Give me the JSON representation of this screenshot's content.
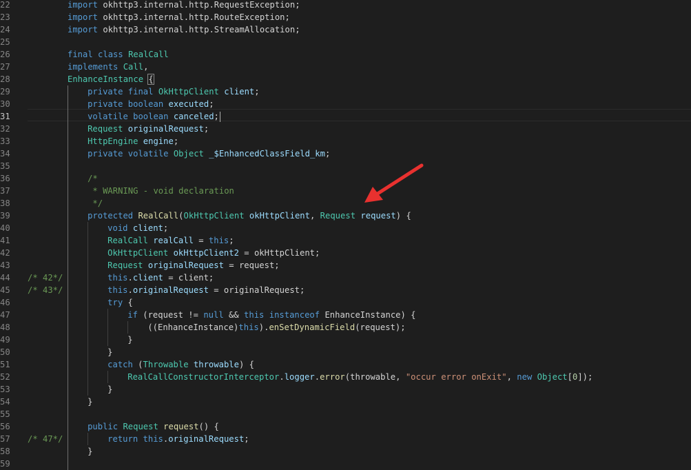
{
  "editor": {
    "lines": [
      {
        "n": "22",
        "indent": 0,
        "tokens": [
          [
            "kw",
            "import"
          ],
          [
            "pl",
            " okhttp3.internal.http.RequestException;"
          ]
        ]
      },
      {
        "n": "23",
        "indent": 0,
        "tokens": [
          [
            "kw",
            "import"
          ],
          [
            "pl",
            " okhttp3.internal.http.RouteException;"
          ]
        ]
      },
      {
        "n": "24",
        "indent": 0,
        "tokens": [
          [
            "kw",
            "import"
          ],
          [
            "pl",
            " okhttp3.internal.http.StreamAllocation;"
          ]
        ]
      },
      {
        "n": "25",
        "indent": 0,
        "tokens": []
      },
      {
        "n": "26",
        "indent": 0,
        "tokens": [
          [
            "kw",
            "final"
          ],
          [
            "pl",
            " "
          ],
          [
            "kw",
            "class"
          ],
          [
            "pl",
            " "
          ],
          [
            "ty",
            "RealCall"
          ]
        ]
      },
      {
        "n": "27",
        "indent": 0,
        "tokens": [
          [
            "kw",
            "implements"
          ],
          [
            "pl",
            " "
          ],
          [
            "ty",
            "Call"
          ],
          [
            "pl",
            ","
          ]
        ]
      },
      {
        "n": "28",
        "indent": 0,
        "tokens": [
          [
            "ty",
            "EnhanceInstance"
          ],
          [
            "pl",
            " "
          ],
          [
            "brace",
            "{"
          ]
        ]
      },
      {
        "n": "29",
        "indent": 1,
        "tokens": [
          [
            "kw",
            "private"
          ],
          [
            "pl",
            " "
          ],
          [
            "kw",
            "final"
          ],
          [
            "pl",
            " "
          ],
          [
            "ty",
            "OkHttpClient"
          ],
          [
            "pl",
            " "
          ],
          [
            "va",
            "client"
          ],
          [
            "pl",
            ";"
          ]
        ]
      },
      {
        "n": "30",
        "indent": 1,
        "tokens": [
          [
            "kw",
            "private"
          ],
          [
            "pl",
            " "
          ],
          [
            "kw",
            "boolean"
          ],
          [
            "pl",
            " "
          ],
          [
            "va",
            "executed"
          ],
          [
            "pl",
            ";"
          ]
        ]
      },
      {
        "n": "31",
        "indent": 1,
        "active": true,
        "tokens": [
          [
            "kw",
            "volatile"
          ],
          [
            "pl",
            " "
          ],
          [
            "kw",
            "boolean"
          ],
          [
            "pl",
            " "
          ],
          [
            "va",
            "canceled"
          ],
          [
            "pl",
            ";"
          ],
          [
            "cursor",
            ""
          ]
        ]
      },
      {
        "n": "32",
        "indent": 1,
        "tokens": [
          [
            "ty",
            "Request"
          ],
          [
            "pl",
            " "
          ],
          [
            "va",
            "originalRequest"
          ],
          [
            "pl",
            ";"
          ]
        ]
      },
      {
        "n": "33",
        "indent": 1,
        "tokens": [
          [
            "ty",
            "HttpEngine"
          ],
          [
            "pl",
            " "
          ],
          [
            "va",
            "engine"
          ],
          [
            "pl",
            ";"
          ]
        ]
      },
      {
        "n": "34",
        "indent": 1,
        "tokens": [
          [
            "kw",
            "private"
          ],
          [
            "pl",
            " "
          ],
          [
            "kw",
            "volatile"
          ],
          [
            "pl",
            " "
          ],
          [
            "ty",
            "Object"
          ],
          [
            "pl",
            " "
          ],
          [
            "va",
            "_$EnhancedClassField_km"
          ],
          [
            "pl",
            ";"
          ]
        ]
      },
      {
        "n": "35",
        "indent": 1,
        "tokens": []
      },
      {
        "n": "36",
        "indent": 1,
        "tokens": [
          [
            "cm",
            "/*"
          ]
        ]
      },
      {
        "n": "37",
        "indent": 1,
        "tokens": [
          [
            "cm",
            " * WARNING - void declaration"
          ]
        ]
      },
      {
        "n": "38",
        "indent": 1,
        "tokens": [
          [
            "cm",
            " */"
          ]
        ]
      },
      {
        "n": "39",
        "indent": 1,
        "tokens": [
          [
            "kw",
            "protected"
          ],
          [
            "pl",
            " "
          ],
          [
            "fn",
            "RealCall"
          ],
          [
            "pl",
            "("
          ],
          [
            "ty",
            "OkHttpClient"
          ],
          [
            "pl",
            " "
          ],
          [
            "va",
            "okHttpClient"
          ],
          [
            "pl",
            ", "
          ],
          [
            "ty",
            "Request"
          ],
          [
            "pl",
            " "
          ],
          [
            "va",
            "request"
          ],
          [
            "pl",
            ") {"
          ]
        ]
      },
      {
        "n": "40",
        "indent": 2,
        "tokens": [
          [
            "kw",
            "void"
          ],
          [
            "pl",
            " "
          ],
          [
            "va",
            "client"
          ],
          [
            "pl",
            ";"
          ]
        ]
      },
      {
        "n": "41",
        "indent": 2,
        "tokens": [
          [
            "ty",
            "RealCall"
          ],
          [
            "pl",
            " "
          ],
          [
            "va",
            "realCall"
          ],
          [
            "pl",
            " = "
          ],
          [
            "kw",
            "this"
          ],
          [
            "pl",
            ";"
          ]
        ]
      },
      {
        "n": "42",
        "indent": 2,
        "tokens": [
          [
            "ty",
            "OkHttpClient"
          ],
          [
            "pl",
            " "
          ],
          [
            "va",
            "okHttpClient2"
          ],
          [
            "pl",
            " = okHttpClient;"
          ]
        ]
      },
      {
        "n": "43",
        "indent": 2,
        "tokens": [
          [
            "ty",
            "Request"
          ],
          [
            "pl",
            " "
          ],
          [
            "va",
            "originalRequest"
          ],
          [
            "pl",
            " = request;"
          ]
        ]
      },
      {
        "n": "44",
        "indent": 2,
        "left": "/* 42*/",
        "tokens": [
          [
            "kw",
            "this"
          ],
          [
            "pl",
            "."
          ],
          [
            "va",
            "client"
          ],
          [
            "pl",
            " = client;"
          ]
        ]
      },
      {
        "n": "45",
        "indent": 2,
        "left": "/* 43*/",
        "tokens": [
          [
            "kw",
            "this"
          ],
          [
            "pl",
            "."
          ],
          [
            "va",
            "originalRequest"
          ],
          [
            "pl",
            " = originalRequest;"
          ]
        ]
      },
      {
        "n": "46",
        "indent": 2,
        "tokens": [
          [
            "kw",
            "try"
          ],
          [
            "pl",
            " {"
          ]
        ]
      },
      {
        "n": "47",
        "indent": 3,
        "tokens": [
          [
            "kw",
            "if"
          ],
          [
            "pl",
            " (request != "
          ],
          [
            "kw",
            "null"
          ],
          [
            "pl",
            " && "
          ],
          [
            "kw",
            "this"
          ],
          [
            "pl",
            " "
          ],
          [
            "kw",
            "instanceof"
          ],
          [
            "pl",
            " EnhanceInstance) {"
          ]
        ]
      },
      {
        "n": "48",
        "indent": 4,
        "tokens": [
          [
            "pl",
            "((EnhanceInstance)"
          ],
          [
            "kw",
            "this"
          ],
          [
            "pl",
            ")."
          ],
          [
            "fn",
            "enSetDynamicField"
          ],
          [
            "pl",
            "(request);"
          ]
        ]
      },
      {
        "n": "49",
        "indent": 3,
        "tokens": [
          [
            "pl",
            "}"
          ]
        ]
      },
      {
        "n": "50",
        "indent": 2,
        "tokens": [
          [
            "pl",
            "}"
          ]
        ]
      },
      {
        "n": "51",
        "indent": 2,
        "tokens": [
          [
            "kw",
            "catch"
          ],
          [
            "pl",
            " ("
          ],
          [
            "ty",
            "Throwable"
          ],
          [
            "pl",
            " "
          ],
          [
            "va",
            "throwable"
          ],
          [
            "pl",
            ") {"
          ]
        ]
      },
      {
        "n": "52",
        "indent": 3,
        "tokens": [
          [
            "ty",
            "RealCallConstructorInterceptor"
          ],
          [
            "pl",
            "."
          ],
          [
            "va",
            "logger"
          ],
          [
            "pl",
            "."
          ],
          [
            "fn",
            "error"
          ],
          [
            "pl",
            "(throwable, "
          ],
          [
            "st",
            "\"occur error onExit\""
          ],
          [
            "pl",
            ", "
          ],
          [
            "kw",
            "new"
          ],
          [
            "pl",
            " "
          ],
          [
            "ty",
            "Object"
          ],
          [
            "pl",
            "["
          ],
          [
            "nu",
            "0"
          ],
          [
            "pl",
            "]);"
          ]
        ]
      },
      {
        "n": "53",
        "indent": 2,
        "tokens": [
          [
            "pl",
            "}"
          ]
        ]
      },
      {
        "n": "54",
        "indent": 1,
        "tokens": [
          [
            "pl",
            "}"
          ]
        ]
      },
      {
        "n": "55",
        "indent": 1,
        "tokens": []
      },
      {
        "n": "56",
        "indent": 1,
        "tokens": [
          [
            "kw",
            "public"
          ],
          [
            "pl",
            " "
          ],
          [
            "ty",
            "Request"
          ],
          [
            "pl",
            " "
          ],
          [
            "fn",
            "request"
          ],
          [
            "pl",
            "() {"
          ]
        ]
      },
      {
        "n": "57",
        "indent": 2,
        "left": "/* 47*/",
        "tokens": [
          [
            "kw",
            "return"
          ],
          [
            "pl",
            " "
          ],
          [
            "kw",
            "this"
          ],
          [
            "pl",
            "."
          ],
          [
            "va",
            "originalRequest"
          ],
          [
            "pl",
            ";"
          ]
        ]
      },
      {
        "n": "58",
        "indent": 1,
        "tokens": [
          [
            "pl",
            "}"
          ]
        ]
      },
      {
        "n": "59",
        "indent": 1,
        "tokens": []
      }
    ]
  },
  "annotation": {
    "arrow_color": "#e8312f",
    "arrow_icon": "red-arrow-icon"
  },
  "colors": {
    "background": "#1e1e1e",
    "keyword": "#569cd6",
    "type": "#4ec9b0",
    "function": "#dcdcaa",
    "variable": "#9cdcfe",
    "string": "#ce9178",
    "comment": "#6a9955",
    "line_number": "#858585"
  }
}
